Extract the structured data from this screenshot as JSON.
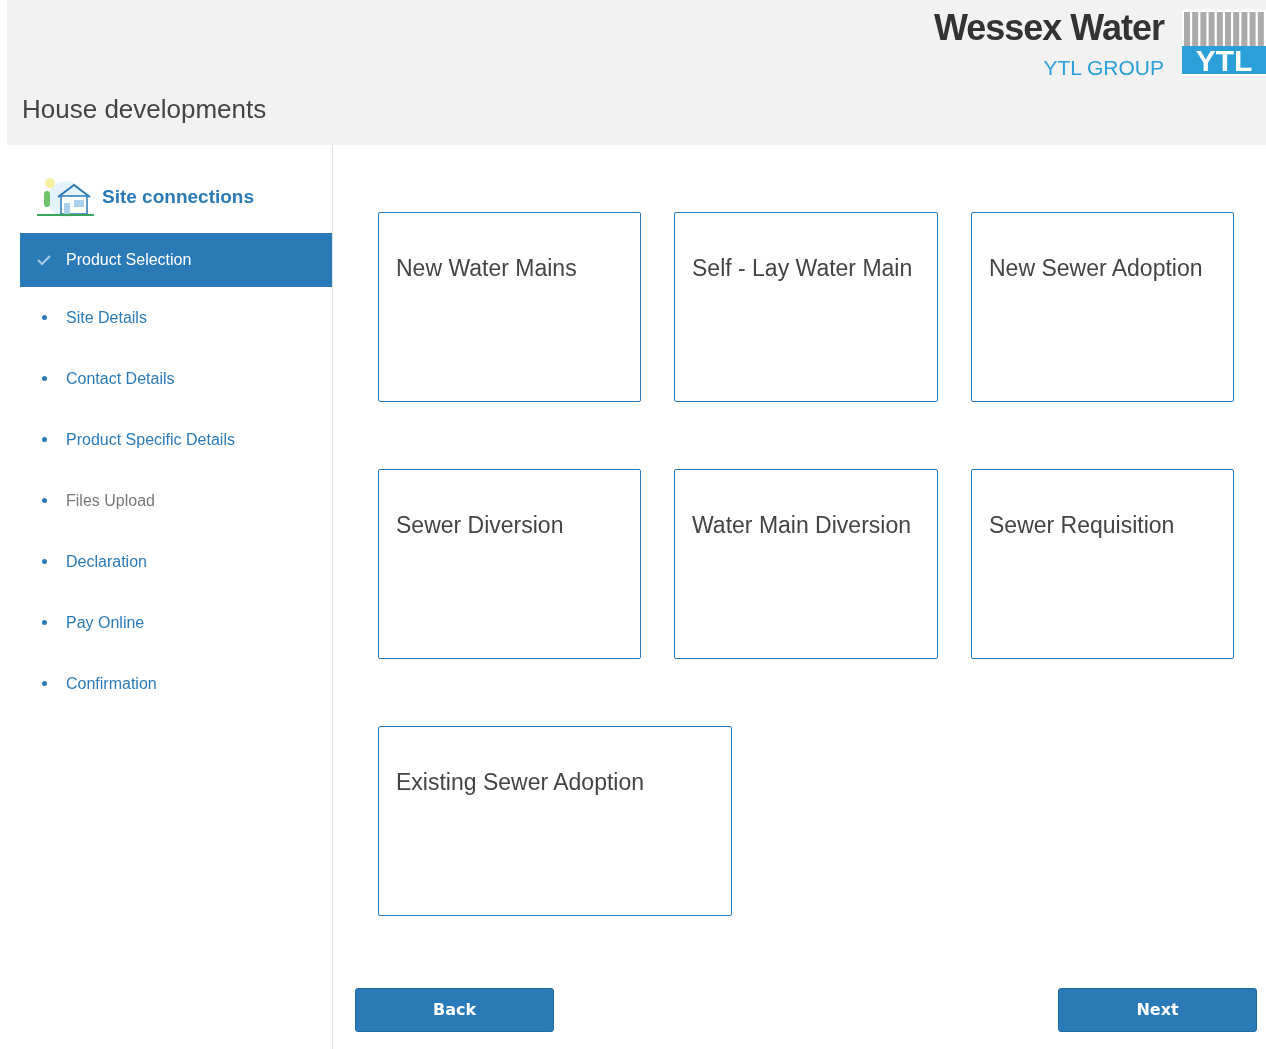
{
  "header": {
    "brand": "Wessex Water",
    "group": "YTL GROUP",
    "mark": "YTL",
    "title": "House developments"
  },
  "sidebar": {
    "title": "Site connections",
    "steps": [
      {
        "label": "Product Selection",
        "selected": true,
        "disabled": false
      },
      {
        "label": "Site Details",
        "selected": false,
        "disabled": false
      },
      {
        "label": "Contact Details",
        "selected": false,
        "disabled": false
      },
      {
        "label": "Product Specific Details",
        "selected": false,
        "disabled": false
      },
      {
        "label": "Files Upload",
        "selected": false,
        "disabled": true
      },
      {
        "label": "Declaration",
        "selected": false,
        "disabled": false
      },
      {
        "label": "Pay Online",
        "selected": false,
        "disabled": false
      },
      {
        "label": "Confirmation",
        "selected": false,
        "disabled": false
      }
    ]
  },
  "products": [
    {
      "label": "New Water Mains",
      "wide": false
    },
    {
      "label": "Self - Lay Water Main",
      "wide": false
    },
    {
      "label": "New Sewer Adoption",
      "wide": false
    },
    {
      "label": "Sewer Diversion",
      "wide": false
    },
    {
      "label": "Water Main Diversion",
      "wide": false
    },
    {
      "label": "Sewer Requisition",
      "wide": false
    },
    {
      "label": "Existing Sewer Adoption",
      "wide": true
    }
  ],
  "buttons": {
    "back": "Back",
    "next": "Next"
  }
}
